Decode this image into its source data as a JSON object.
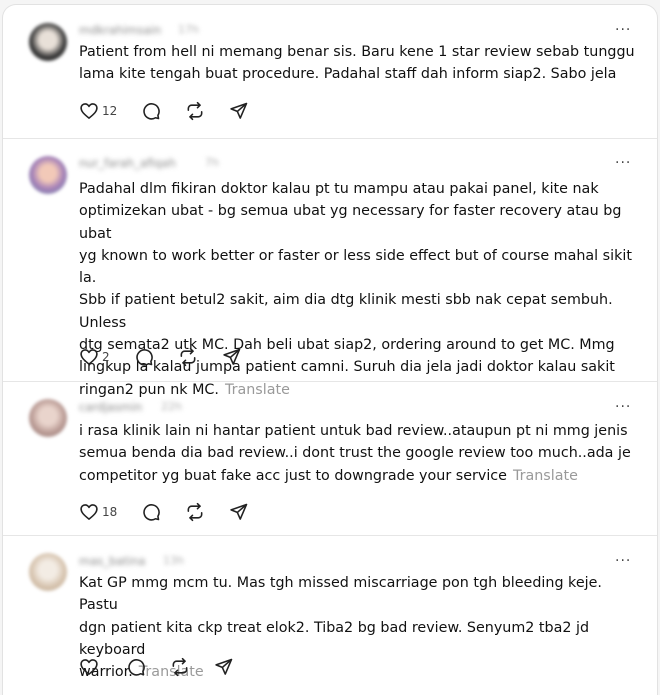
{
  "posts": [
    {
      "username": "mdkrahimsain",
      "time": "17h",
      "text": "Patient from hell ni memang benar sis. Baru kene 1 star review sebab tunggu\nlama kite tengah buat procedure. Padahal staff dah inform siap2. Sabo jela",
      "translate": "",
      "likes": "12",
      "avatar_color": "#4a4a4a"
    },
    {
      "username": "nur_farah_afiqah",
      "time": "7h",
      "text": "Padahal dlm fikiran doktor kalau pt tu mampu atau pakai panel, kite nak\noptimizekan ubat - bg semua ubat yg necessary for faster recovery atau bg ubat\nyg known to work better or faster or less side effect but of course mahal sikit la.\nSbb if patient betul2 sakit, aim dia dtg klinik mesti sbb nak cepat sembuh. Unless\ndtg semata2 utk MC. Dah beli ubat siap2, ordering around to get MC. Mmg\nlingkup la kalau jumpa patient camni. Suruh dia jela jadi doktor kalau sakit\nringan2 pun nk MC.",
      "translate": "Translate",
      "likes": "2",
      "avatar_color": "#8a6f9e"
    },
    {
      "username": "cardjasmin",
      "time": "22h",
      "text": "i rasa klinik lain ni hantar patient untuk bad review..ataupun pt ni mmg jenis\nsemua benda dia bad review..i dont trust the google review too much..ada je\ncompetitor yg buat fake acc just to downgrade your service",
      "translate": "Translate",
      "likes": "18",
      "avatar_color": "#c9a7a0"
    },
    {
      "username": "mas_batina",
      "time": "13h",
      "text": "Kat GP mmg mcm tu. Mas tgh missed miscarriage pon tgh bleeding keje. Pastu\ndgn patient kita ckp treat elok2. Tiba2 bg bad review. Senyum2 tba2 jd keyboard\nwarrior.",
      "translate": "Translate",
      "likes": "",
      "avatar_color": "#d8c7b5"
    }
  ],
  "more_icon": "ellipsis-icon",
  "action_icons": [
    "heart-icon",
    "comment-icon",
    "repost-icon",
    "share-icon"
  ]
}
